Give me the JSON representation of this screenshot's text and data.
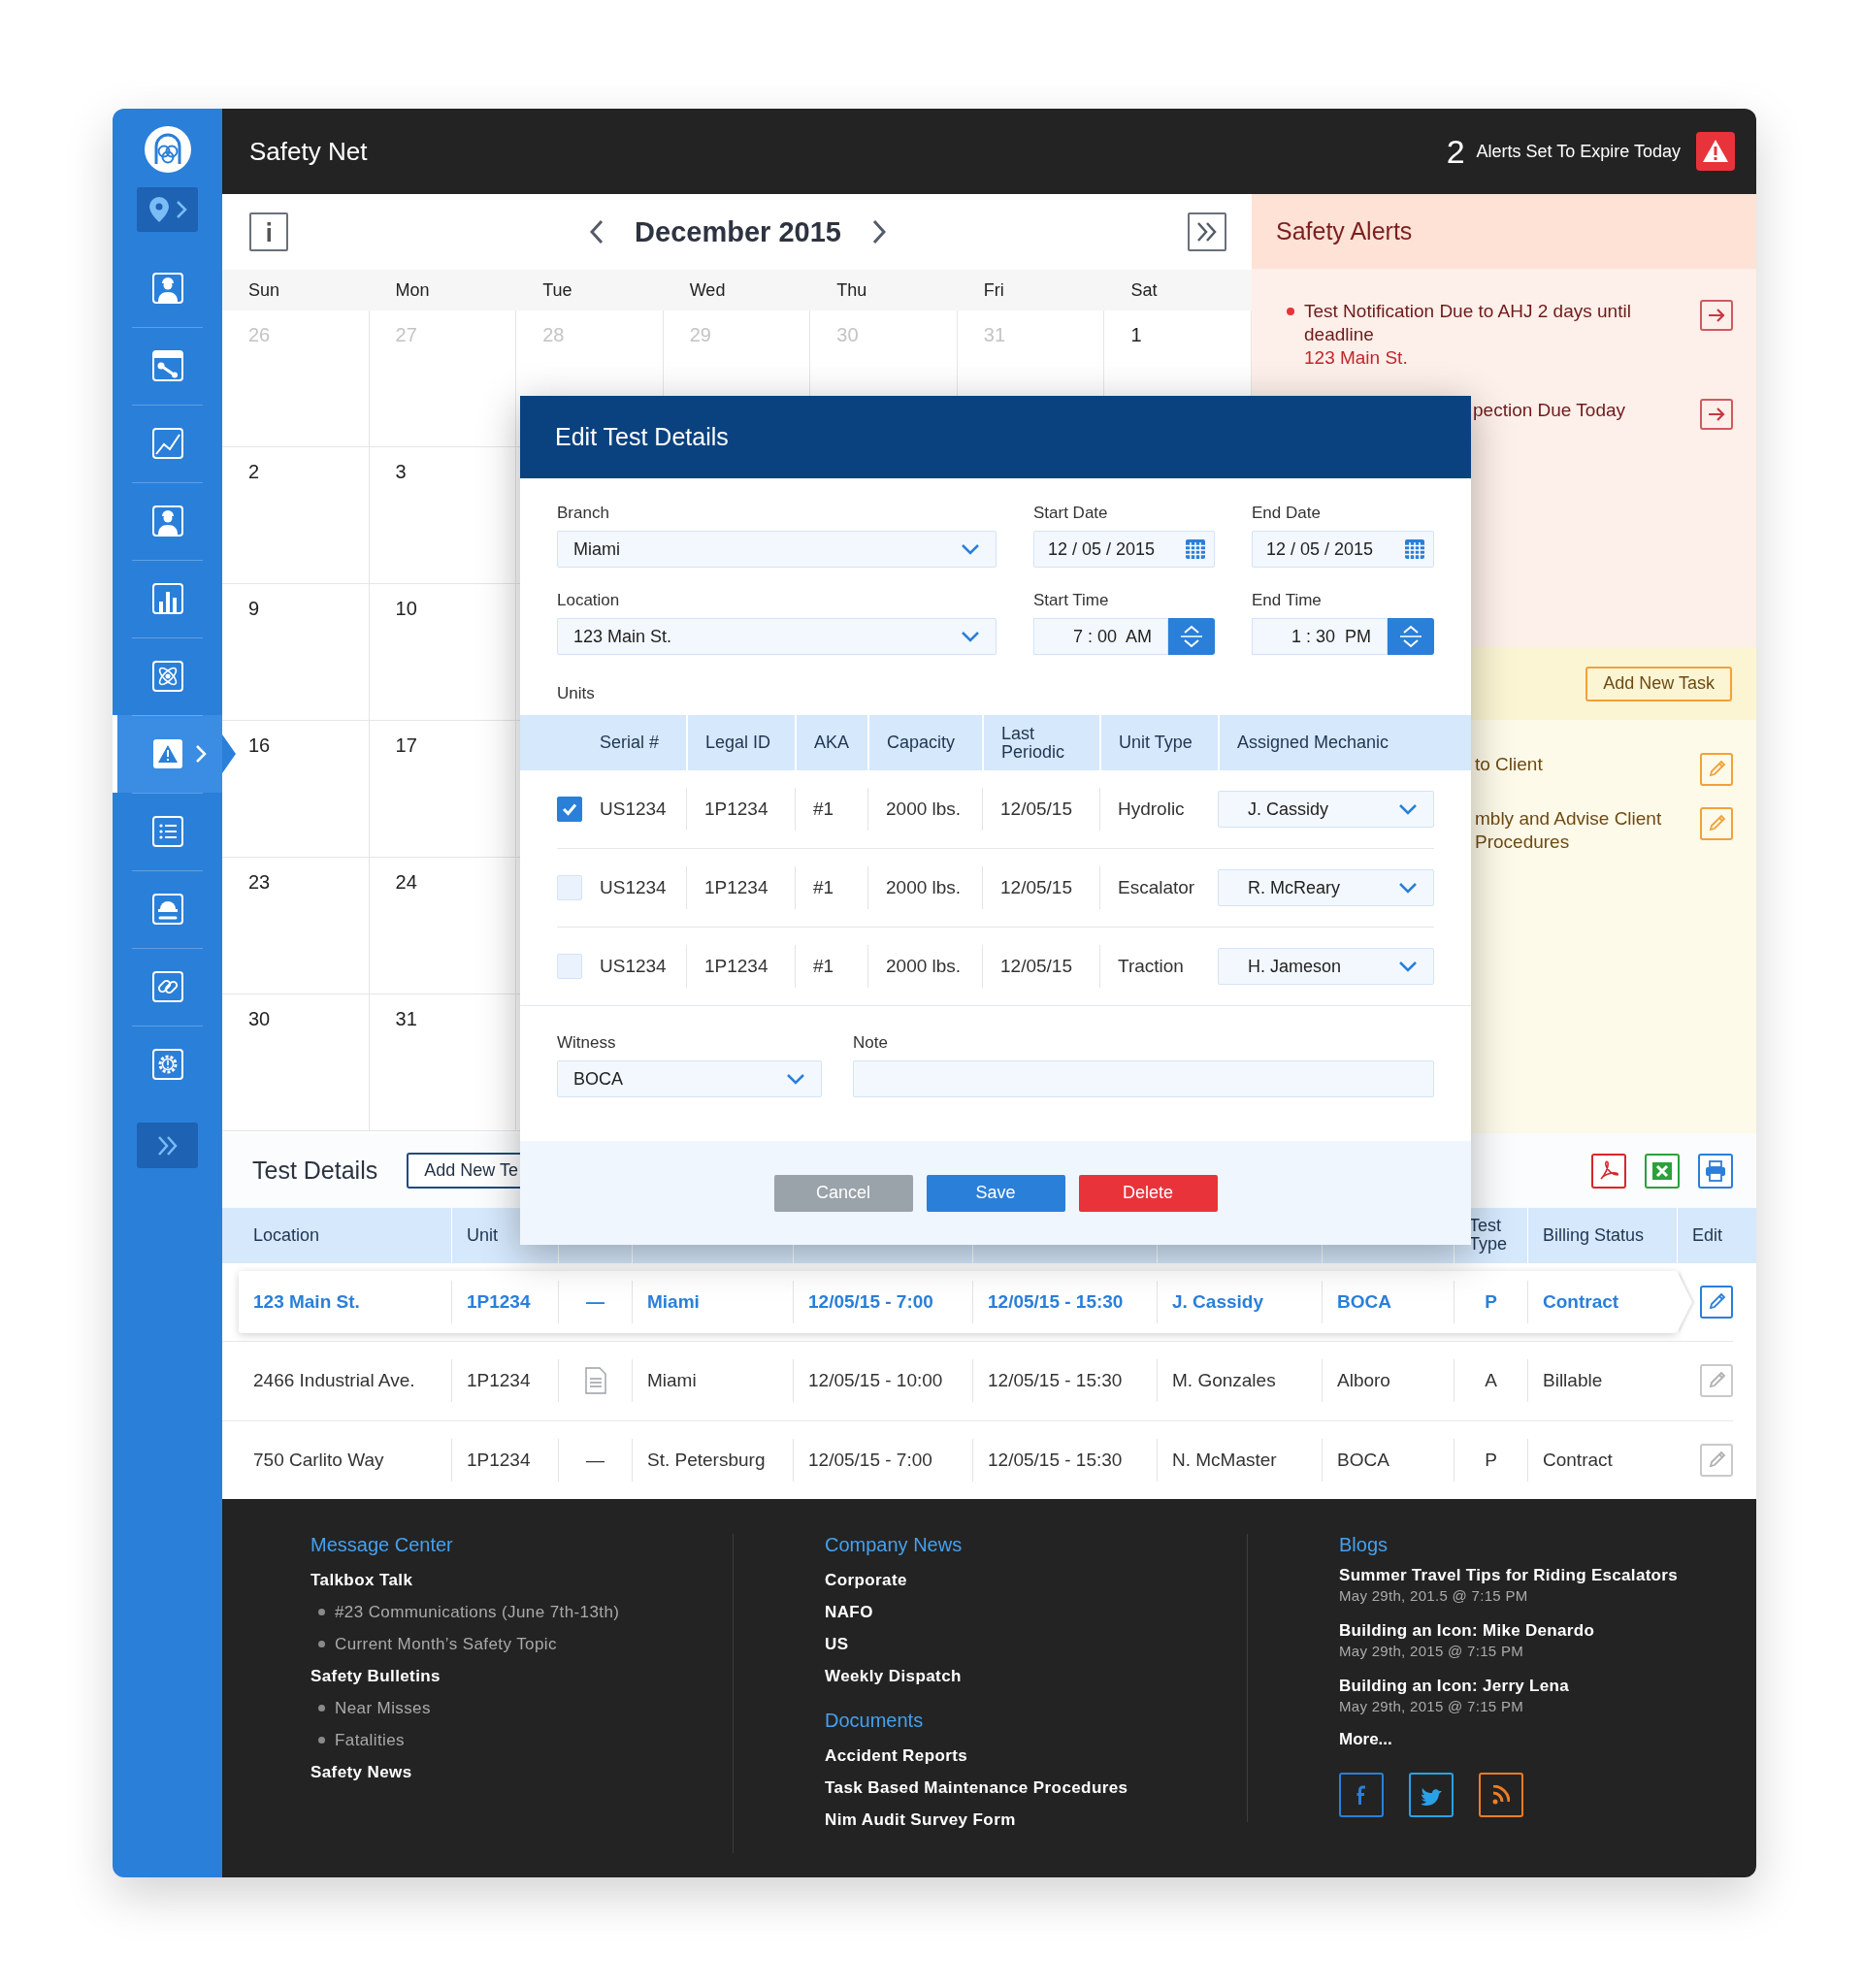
{
  "header": {
    "title": "Safety Net",
    "alert_count": "2",
    "alert_text": "Alerts Set To Expire Today"
  },
  "sidebar": {
    "items": [
      {
        "kind": "worker",
        "selected": false
      },
      {
        "kind": "wrench-window",
        "selected": false
      },
      {
        "kind": "line-chart",
        "selected": false
      },
      {
        "kind": "worker",
        "selected": false
      },
      {
        "kind": "bar-chart",
        "selected": false
      },
      {
        "kind": "atom",
        "selected": false
      },
      {
        "kind": "warning",
        "selected": true
      },
      {
        "kind": "list",
        "selected": false
      },
      {
        "kind": "helmet-wrench",
        "selected": false
      },
      {
        "kind": "link",
        "selected": false
      },
      {
        "kind": "gear",
        "selected": false
      }
    ]
  },
  "calendar": {
    "month": "December 2015",
    "weekdays": [
      "Sun",
      "Mon",
      "Tue",
      "Wed",
      "Thu",
      "Fri",
      "Sat"
    ],
    "weeks": [
      {
        "days": [
          {
            "day": "26",
            "muted": true
          },
          {
            "day": "27",
            "muted": true
          },
          {
            "day": "28",
            "muted": true
          },
          {
            "day": "29",
            "muted": true
          },
          {
            "day": "30",
            "muted": true
          },
          {
            "day": "31",
            "muted": true
          },
          {
            "day": "1",
            "muted": false
          }
        ]
      },
      {
        "days": [
          {
            "day": "2",
            "muted": false
          },
          {
            "day": "3",
            "muted": false
          }
        ]
      },
      {
        "days": [
          {
            "day": "9",
            "muted": false
          },
          {
            "day": "10",
            "muted": false
          }
        ]
      },
      {
        "days": [
          {
            "day": "16",
            "muted": false
          },
          {
            "day": "17",
            "muted": false
          }
        ]
      },
      {
        "days": [
          {
            "day": "23",
            "muted": false
          },
          {
            "day": "24",
            "muted": false
          }
        ]
      },
      {
        "days": [
          {
            "day": "30",
            "muted": false
          },
          {
            "day": "31",
            "muted": false
          }
        ]
      }
    ]
  },
  "safety_alerts": {
    "title": "Safety Alerts",
    "items": [
      {
        "text": "Test Notification Due to AHJ 2 days until deadline",
        "location": "123 Main St."
      }
    ],
    "partially_covered_items": [
      {
        "text": "pection Due Today"
      }
    ]
  },
  "tasks": {
    "button": "Add New Task",
    "partially_covered_items": [
      {
        "text": "to Client"
      },
      {
        "text": "mbly and Advise Client Procedures"
      }
    ]
  },
  "test_details": {
    "title": "Test Details",
    "add_button": "Add New Te",
    "columns_start": [
      "Location",
      "Unit"
    ],
    "columns_end": [
      "Test Type",
      "Billing Status",
      "Edit"
    ],
    "rows": [
      {
        "selected": true,
        "location": "123 Main St.",
        "unit": "1P1234",
        "attachment": {
          "kind": "dash",
          "text": "—"
        },
        "branch": "Miami",
        "start": "12/05/15 - 7:00",
        "end": "12/05/15 - 15:30",
        "mechanic": "J. Cassidy",
        "witness": "BOCA",
        "test_type": "P",
        "billing": "Contract"
      },
      {
        "selected": false,
        "location": "2466 Industrial Ave.",
        "unit": "1P1234",
        "attachment": {
          "kind": "document"
        },
        "branch": "Miami",
        "start": "12/05/15 - 10:00",
        "end": "12/05/15 - 15:30",
        "mechanic": "M. Gonzales",
        "witness": "Alboro",
        "test_type": "A",
        "billing": "Billable"
      },
      {
        "selected": false,
        "location": "750 Carlito Way",
        "unit": "1P1234",
        "attachment": {
          "kind": "dash",
          "text": "—"
        },
        "branch": "St. Petersburg",
        "start": "12/05/15 - 7:00",
        "end": "12/05/15 - 15:30",
        "mechanic": "N. McMaster",
        "witness": "BOCA",
        "test_type": "P",
        "billing": "Contract"
      }
    ]
  },
  "dialog": {
    "title": "Edit Test Details",
    "branch": {
      "label": "Branch",
      "value": "Miami"
    },
    "start_date": {
      "label": "Start Date",
      "value": "12 / 05 / 2015"
    },
    "end_date": {
      "label": "End Date",
      "value": "12 / 05 / 2015"
    },
    "location": {
      "label": "Location",
      "value": "123 Main St."
    },
    "start_time": {
      "label": "Start Time",
      "value": "7 : 00  AM"
    },
    "end_time": {
      "label": "End Time",
      "value": "1 : 30  PM"
    },
    "units_label": "Units",
    "unit_columns": [
      "Serial #",
      "Legal ID",
      "AKA",
      "Capacity",
      "Last Periodic",
      "Unit Type",
      "Assigned Mechanic"
    ],
    "units": [
      {
        "checked": true,
        "serial": "US1234",
        "legal_id": "1P1234",
        "aka": "#1",
        "capacity": "2000 lbs.",
        "last_periodic": "12/05/15",
        "unit_type": "Hydrolic",
        "mechanic": "J. Cassidy"
      },
      {
        "checked": false,
        "serial": "US1234",
        "legal_id": "1P1234",
        "aka": "#1",
        "capacity": "2000 lbs.",
        "last_periodic": "12/05/15",
        "unit_type": "Escalator",
        "mechanic": "R. McReary"
      },
      {
        "checked": false,
        "serial": "US1234",
        "legal_id": "1P1234",
        "aka": "#1",
        "capacity": "2000 lbs.",
        "last_periodic": "12/05/15",
        "unit_type": "Traction",
        "mechanic": "H. Jameson"
      }
    ],
    "witness": {
      "label": "Witness",
      "value": "BOCA"
    },
    "note": {
      "label": "Note"
    },
    "buttons": [
      {
        "kind": "cancel",
        "label": "Cancel"
      },
      {
        "kind": "save",
        "label": "Save"
      },
      {
        "kind": "delete",
        "label": "Delete"
      }
    ]
  },
  "footer": {
    "columns": [
      {
        "sections": [
          {
            "heading": "Message Center",
            "items": [
              {
                "kind": "link",
                "text": "Talkbox Talk"
              },
              {
                "kind": "bullet",
                "text": "#23 Communications (June 7th-13th)"
              },
              {
                "kind": "bullet",
                "text": "Current Month’s Safety Topic"
              },
              {
                "kind": "link",
                "text": "Safety Bulletins"
              },
              {
                "kind": "bullet",
                "text": "Near Misses"
              },
              {
                "kind": "bullet",
                "text": "Fatalities"
              },
              {
                "kind": "link",
                "text": "Safety News"
              }
            ]
          }
        ]
      },
      {
        "sections": [
          {
            "heading": "Company News",
            "items": [
              {
                "kind": "link",
                "text": "Corporate"
              },
              {
                "kind": "link",
                "text": "NAFO"
              },
              {
                "kind": "link",
                "text": "US"
              },
              {
                "kind": "link",
                "text": "Weekly Dispatch"
              }
            ]
          },
          {
            "heading": "Documents",
            "items": [
              {
                "kind": "link",
                "text": "Accident Reports"
              },
              {
                "kind": "link",
                "text": "Task Based Maintenance Procedures"
              },
              {
                "kind": "link",
                "text": "Nim Audit Survey Form"
              }
            ]
          }
        ]
      }
    ],
    "blogs": {
      "heading": "Blogs",
      "posts": [
        {
          "title": "Summer Travel Tips for Riding Escalators",
          "date": "May 29th, 201.5 @ 7:15 PM"
        },
        {
          "title": "Building an Icon: Mike Denardo",
          "date": "May 29th, 2015 @ 7:15 PM"
        },
        {
          "title": "Building an Icon: Jerry Lena",
          "date": "May 29th, 2015 @ 7:15 PM"
        }
      ],
      "more": "More...",
      "social": [
        {
          "kind": "facebook"
        },
        {
          "kind": "twitter"
        },
        {
          "kind": "rss"
        }
      ]
    }
  }
}
